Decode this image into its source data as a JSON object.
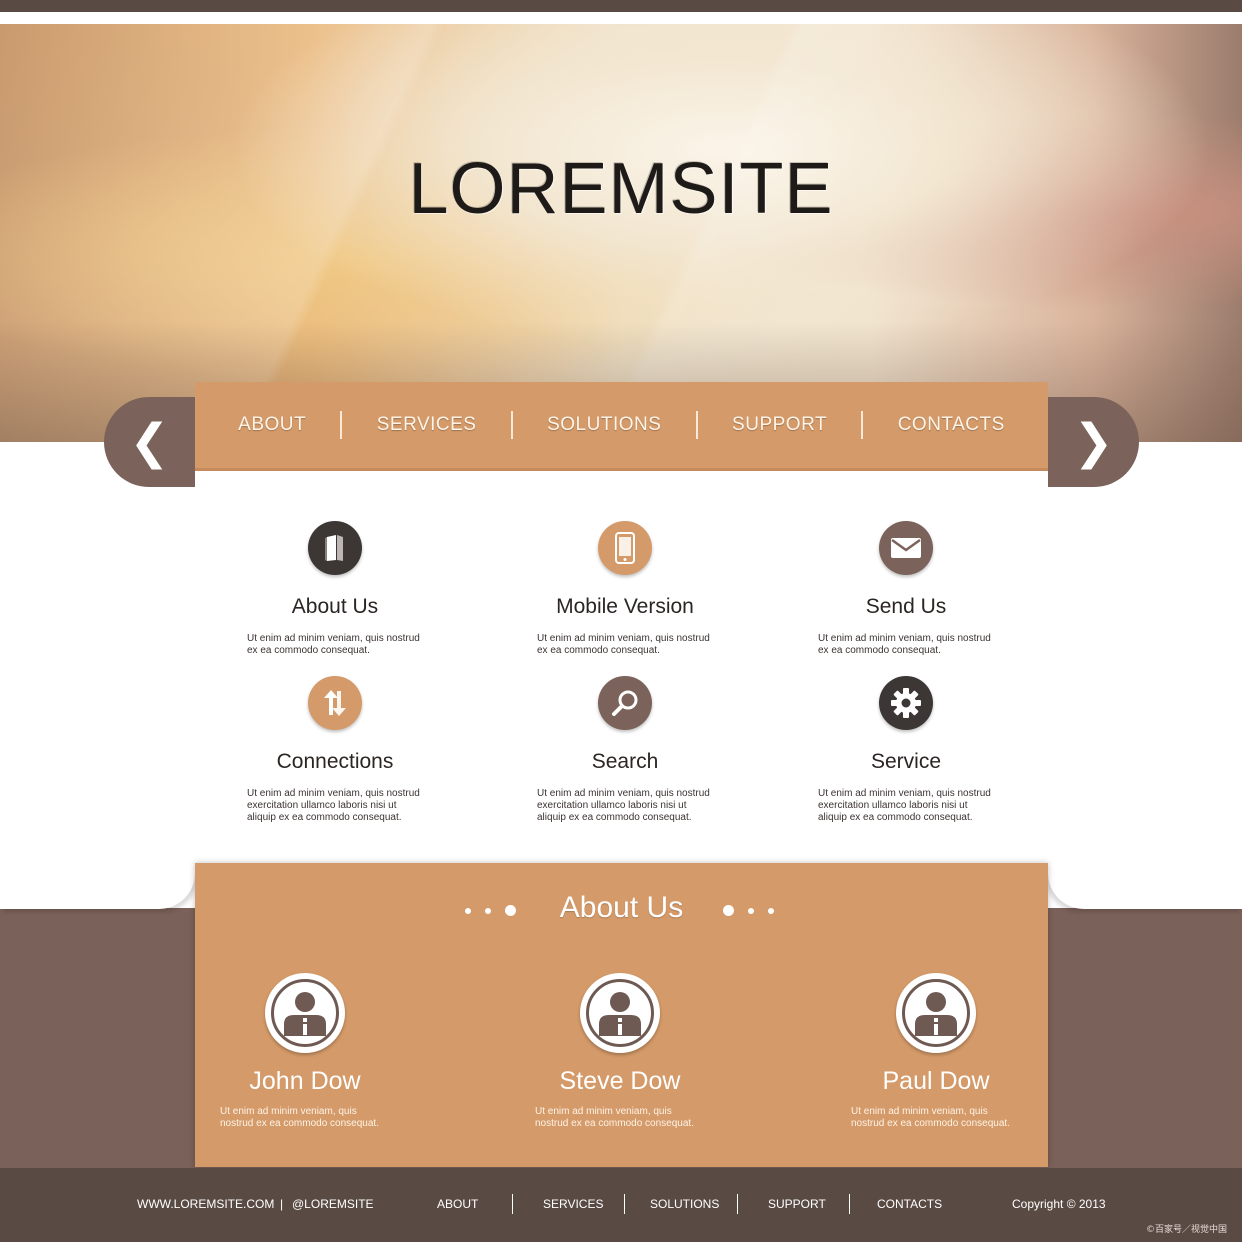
{
  "site": {
    "title": "LOREMSITE"
  },
  "nav": {
    "items": [
      "ABOUT",
      "SERVICES",
      "SOLUTIONS",
      "SUPPORT",
      "CONTACTS"
    ],
    "prev_glyph": "❮",
    "next_glyph": "❯"
  },
  "features": [
    {
      "title": "About Us",
      "text": "Ut enim ad minim veniam, quis nostrud ex ea commodo consequat.",
      "icon": "book-icon"
    },
    {
      "title": "Mobile Version",
      "text": "Ut enim ad minim veniam, quis nostrud ex ea commodo consequat.",
      "icon": "mobile-phone-icon"
    },
    {
      "title": "Send Us",
      "text": "Ut enim ad minim veniam, quis nostrud ex ea commodo consequat.",
      "icon": "envelope-icon"
    },
    {
      "title": "Connections",
      "text": "Ut enim ad minim veniam, quis nostrud exercitation ullamco laboris nisi ut aliquip ex ea commodo consequat.",
      "icon": "exchange-arrows-icon"
    },
    {
      "title": "Search",
      "text": "Ut enim ad minim veniam, quis nostrud exercitation ullamco laboris nisi ut aliquip ex ea commodo consequat.",
      "icon": "magnifier-icon"
    },
    {
      "title": "Service",
      "text": "Ut enim ad minim veniam, quis nostrud exercitation ullamco laboris nisi ut aliquip ex ea commodo consequat.",
      "icon": "gear-icon"
    }
  ],
  "about": {
    "heading": "About Us",
    "people": [
      {
        "name": "John Dow",
        "text": "Ut enim ad minim veniam, quis nostrud ex ea commodo consequat."
      },
      {
        "name": "Steve Dow",
        "text": "Ut enim ad minim veniam, quis nostrud ex ea commodo consequat."
      },
      {
        "name": "Paul Dow",
        "text": "Ut enim ad minim veniam, quis nostrud ex ea commodo consequat."
      }
    ]
  },
  "footer": {
    "website": "WWW.LOREMSITE.COM",
    "divider": "|",
    "handle": "@LOREMSITE",
    "links": [
      "ABOUT",
      "SERVICES",
      "SOLUTIONS",
      "SUPPORT",
      "CONTACTS"
    ],
    "copyright": "Copyright © 2013"
  },
  "watermark": "©百家号／视觉中国",
  "colors": {
    "accent": "#d49a69",
    "brown": "#7b625a",
    "dark": "#5a4a44",
    "icon_dark": "#3c3735"
  }
}
